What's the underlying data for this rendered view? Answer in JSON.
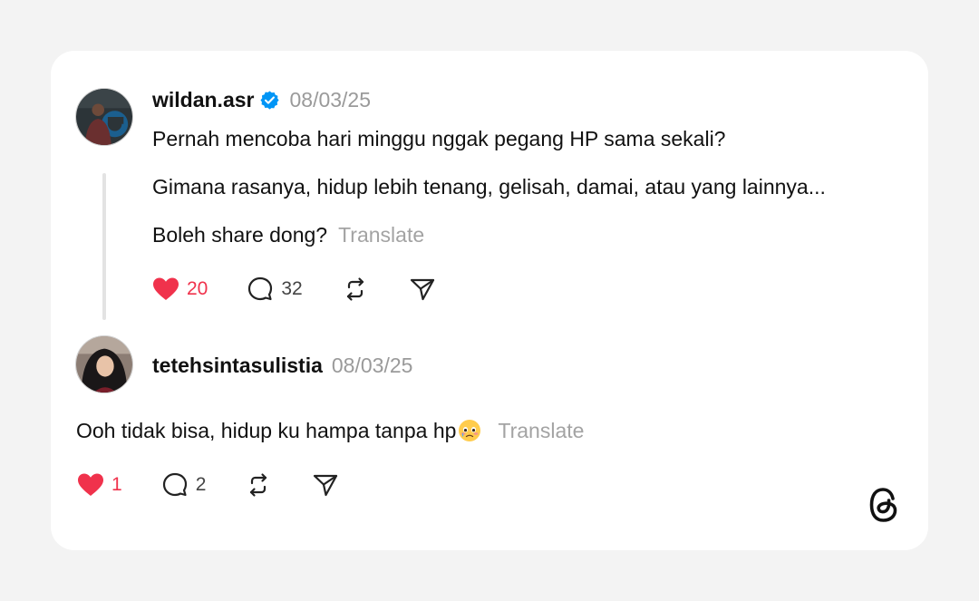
{
  "post": {
    "username": "wildan.asr",
    "verified": true,
    "date": "08/03/25",
    "lines": [
      "Pernah mencoba hari minggu nggak pegang HP sama sekali?",
      "Gimana rasanya, hidup lebih tenang, gelisah, damai, atau yang lainnya...",
      "Boleh share dong?"
    ],
    "translate_label": "Translate",
    "likes": "20",
    "replies": "32",
    "liked": true
  },
  "reply": {
    "username": "tetehsintasulistia",
    "date": "08/03/25",
    "text": "Ooh tidak bisa, hidup ku hampa tanpa hp",
    "emoji_icon": "face-holding-back-tears-icon",
    "translate_label": "Translate",
    "likes": "1",
    "replies": "2",
    "liked": true
  },
  "icons": {
    "like": "heart-icon",
    "reply": "speech-bubble-icon",
    "repost": "repost-icon",
    "share": "send-icon",
    "brand": "threads-logo-icon",
    "verified": "verified-badge-icon"
  },
  "colors": {
    "like_red": "#f0324c",
    "verified_blue": "#0095f6",
    "muted_gray": "#9a9a9a"
  }
}
